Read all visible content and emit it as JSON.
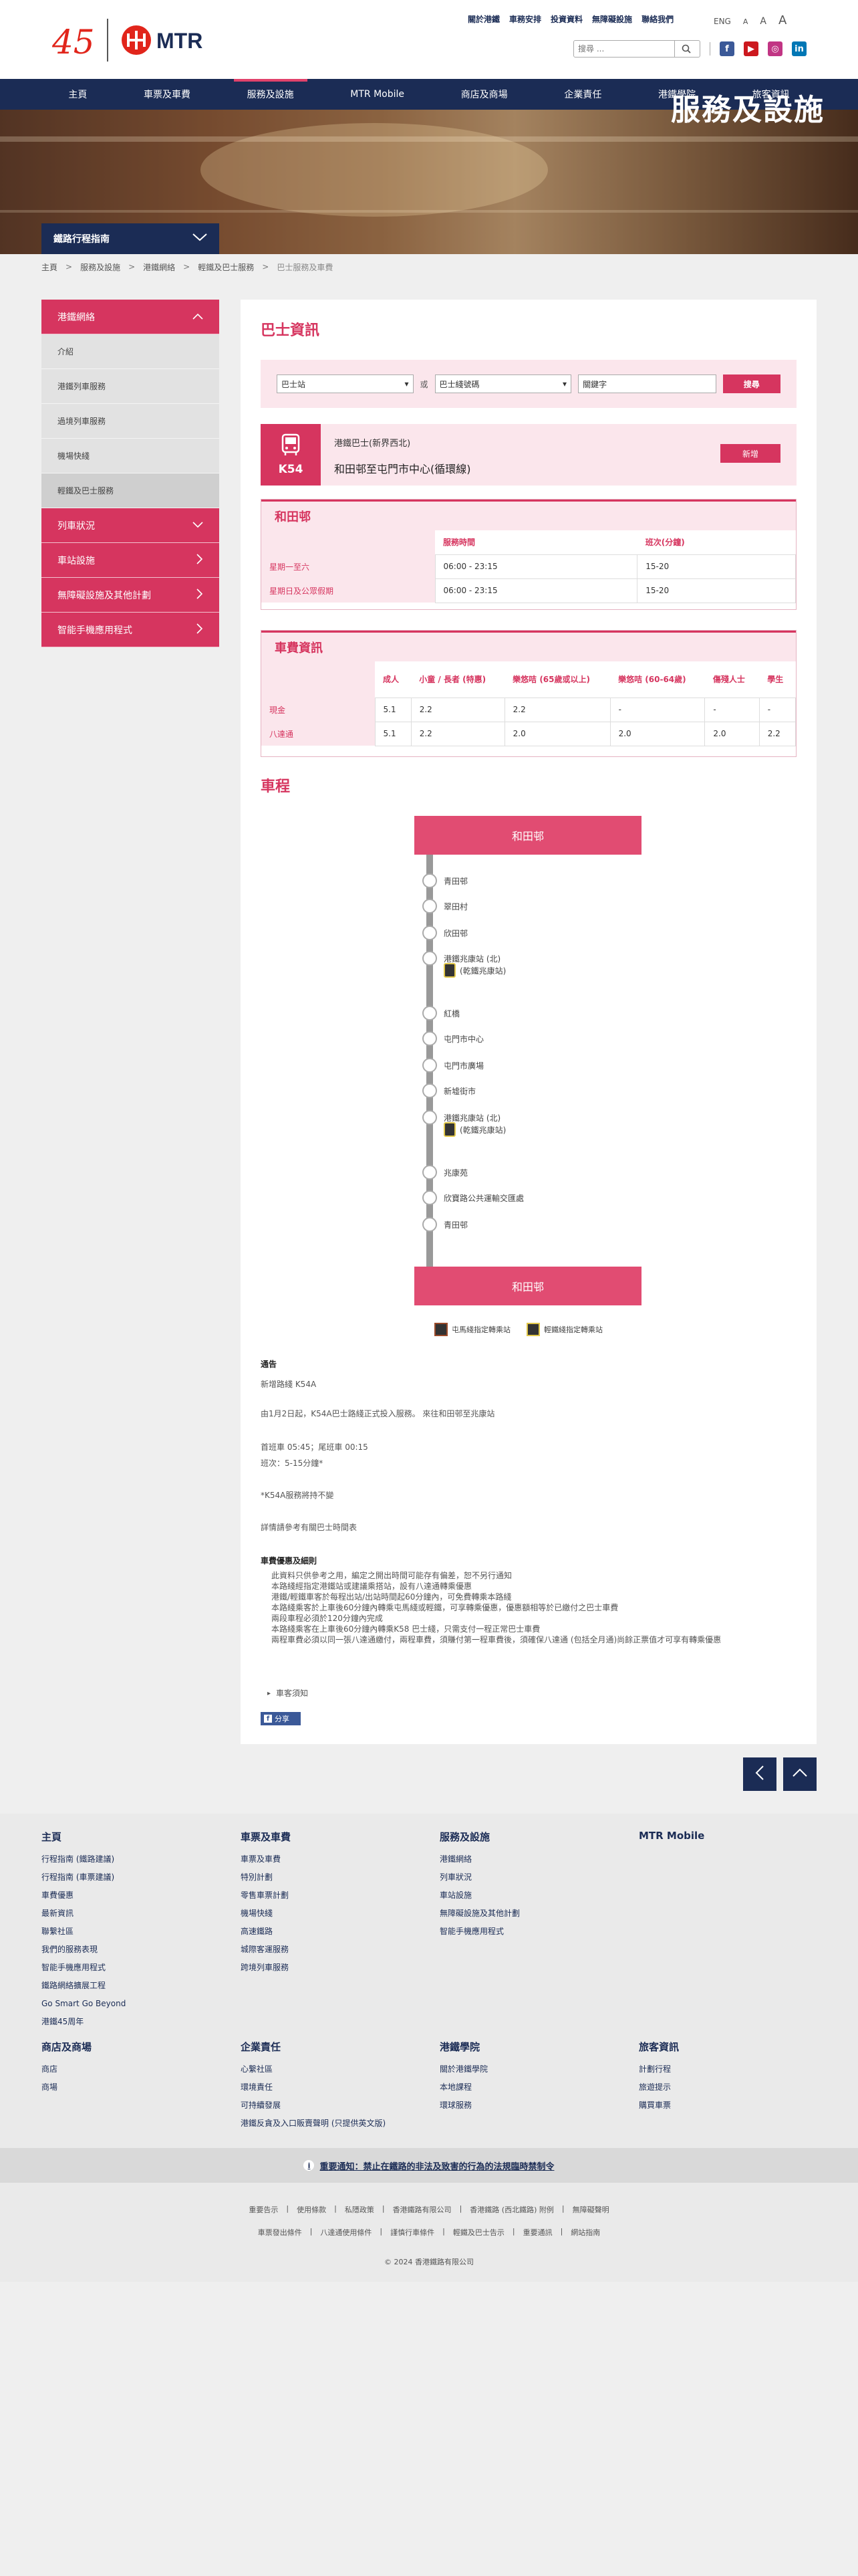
{
  "header": {
    "top_links": [
      "關於港鐵",
      "車務安排",
      "投資資料",
      "無障礙設施",
      "聯絡我們"
    ],
    "lang": {
      "eng": "ENG",
      "a_small": "A",
      "a_mid": "A",
      "a_large": "A"
    },
    "search_placeholder": "搜尋 ...",
    "logo_text": "MTR",
    "logo_45": "45"
  },
  "nav": {
    "items": [
      "主頁",
      "車票及車費",
      "服務及設施",
      "MTR Mobile",
      "商店及商場",
      "企業責任",
      "港鐵學院",
      "旅客資訊"
    ],
    "active_index": 2
  },
  "banner": {
    "title": "服務及設施",
    "trip_planner": "鐵路行程指南"
  },
  "breadcrumb": [
    "主頁",
    "服務及設施",
    "港鐵網絡",
    "輕鐵及巴士服務",
    "巴士服務及車費"
  ],
  "sidebar": {
    "network": "港鐵網絡",
    "sub_items": [
      "介紹",
      "港鐵列車服務",
      "過境列車服務",
      "機場快綫",
      "輕鐵及巴士服務"
    ],
    "other_items": [
      "列車狀況",
      "車站設施",
      "無障礙設施及其他計劃",
      "智能手機應用程式"
    ]
  },
  "bus_info": {
    "title": "巴士資訊",
    "search": {
      "stop_select": "巴士站",
      "or": "或",
      "route_select": "巴士綫號碼",
      "keyword_placeholder": "關鍵字",
      "button": "搜尋"
    },
    "route": {
      "number": "K54",
      "operator": "港鐵巴士(新界西北)",
      "name": "和田邨至屯門市中心(循環線)",
      "new_label": "新增"
    }
  },
  "schedule": {
    "heading": "和田邨",
    "columns": [
      "服務時間",
      "班次(分鐘)"
    ],
    "rows": [
      {
        "day": "星期一至六",
        "time": "06:00 - 23:15",
        "freq": "15-20"
      },
      {
        "day": "星期日及公眾假期",
        "time": "06:00 - 23:15",
        "freq": "15-20"
      }
    ]
  },
  "fares": {
    "heading": "車費資訊",
    "columns": [
      "成人",
      "小童 / 長者 (特惠)",
      "樂悠咭 (65歲或以上)",
      "樂悠咭 (60-64歲)",
      "傷殘人士",
      "學生"
    ],
    "rows": [
      {
        "type": "現金",
        "values": [
          "5.1",
          "2.2",
          "2.2",
          "-",
          "-",
          "-"
        ]
      },
      {
        "type": "八達通",
        "values": [
          "5.1",
          "2.2",
          "2.0",
          "2.0",
          "2.0",
          "2.2"
        ]
      }
    ]
  },
  "route_section": {
    "title": "車程",
    "start": "和田邨",
    "end": "和田邨",
    "stops": [
      {
        "name": "青田邨"
      },
      {
        "name": "翠田村"
      },
      {
        "name": "欣田邨"
      },
      {
        "name": "港鐵兆康站 (北)",
        "sub": "(乾鐵兆康站)",
        "interchange": true
      },
      {
        "name": "紅橋"
      },
      {
        "name": "屯門市中心"
      },
      {
        "name": "屯門市廣場"
      },
      {
        "name": "新墟街市"
      },
      {
        "name": "港鐵兆康站 (北)",
        "sub": "(乾鐵兆康站)",
        "interchange": true
      },
      {
        "name": "兆康苑"
      },
      {
        "name": "欣寶路公共運輸交匯處"
      },
      {
        "name": "青田邨"
      }
    ],
    "legend": [
      "屯馬綫指定轉乘站",
      "輕鐵綫指定轉乘站"
    ]
  },
  "notice": {
    "title": "通告",
    "new_route": "新增路綫 K54A",
    "para1": "由1月2日起，K54A巴士路綫正式投入服務。 來往和田邨至兆康站",
    "para2": "首班車 05:45；尾班車 00:15",
    "para3": "班次：5-15分鐘*",
    "para4": "*K54A服務將持不變",
    "para5": "詳情請參考有關巴士時間表",
    "fare_title": "車費優惠及細則",
    "fare_lines": [
      "此資料只供參考之用，編定之開出時間可能存有偏差，恕不另行通知",
      "本路綫經指定港鐵站或建議乘搭站，設有八達通轉乘優惠",
      "港鐵/輕鐵車客於每程出站/出站時間起60分鐘內，可免費轉乘本路綫",
      "本路綫乘客於上車後60分鐘內轉乘屯馬綫或輕鐵，可享轉乘優惠，優惠額相等於已繳付之巴士車費",
      "兩段車程必須於120分鐘內完成",
      "本路綫乘客在上車後60分鐘內轉乘K58 巴士綫，只需支付一程正常巴士車費",
      "兩程車費必須以同一張八達通繳付，兩程車費，須賺付第一程車費後，須確保八達通 (包括全月通)尚餘正票值才可享有轉乘優惠"
    ],
    "more": "車客須知",
    "share": "分享"
  },
  "footer": {
    "col1": {
      "title": "主頁",
      "items": [
        "行程指南 (鐵路建議)",
        "行程指南 (車票建議)",
        "車費優惠",
        "最新資訊",
        "聯繫社區",
        "我們的服務表現",
        "智能手機應用程式",
        "鐵路網絡擴展工程",
        "Go Smart Go Beyond",
        "港鐵45周年"
      ]
    },
    "col2": {
      "title": "車票及車費",
      "items": [
        "車票及車費",
        "特別計劃",
        "零售車票計劃",
        "機場快綫",
        "高速鐵路",
        "城際客運服務",
        "跨境列車服務"
      ]
    },
    "col3": {
      "title": "服務及設施",
      "items": [
        "港鐵網絡",
        "列車狀況",
        "車站設施",
        "無障礙設施及其他計劃",
        "智能手機應用程式"
      ]
    },
    "col4": {
      "title": "MTR Mobile",
      "items": []
    },
    "col5": {
      "title": "商店及商場",
      "items": [
        "商店",
        "商場"
      ]
    },
    "col6": {
      "title": "企業責任",
      "items": [
        "心繫社區",
        "環境責任",
        "可持續發展",
        "港鐵反貪及入口販賣聲明 (只提供英文版)"
      ]
    },
    "col7": {
      "title": "港鐵學院",
      "items": [
        "關於港鐵學院",
        "本地課程",
        "環球服務"
      ]
    },
    "col8": {
      "title": "旅客資訊",
      "items": [
        "計劃行程",
        "旅遊提示",
        "購買車票"
      ]
    },
    "notice": "重要通知：禁止在鐵路的非法及致害的行為的法規臨時禁制令",
    "links_row1": [
      "重要告示",
      "使用條款",
      "私隱政策",
      "香港鐵路有限公司",
      "香港鐵路 (西北鐵路) 附例",
      "無障礙聲明"
    ],
    "links_row2": [
      "車票發出條件",
      "八達通使用條件",
      "謹慎行車條件",
      "輕鐵及巴士告示",
      "重要通訊",
      "網站指南"
    ],
    "copyright": "© 2024 香港鐵路有限公司"
  },
  "colors": {
    "brand_navy": "#1b2c55",
    "accent_pink": "#d6355f",
    "brand_red": "#e1251b"
  }
}
